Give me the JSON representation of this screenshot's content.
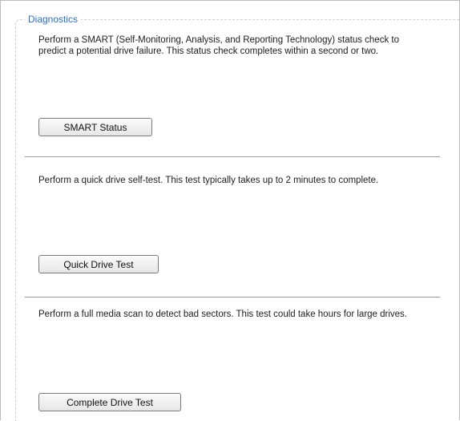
{
  "legend": "Diagnostics",
  "sections": [
    {
      "description": "Perform a SMART (Self-Monitoring, Analysis, and Reporting Technology) status check to predict a potential drive failure. This status check completes within a second or two.",
      "button_label": "SMART Status"
    },
    {
      "description": "Perform a quick drive self-test. This test typically takes up to 2 minutes to complete.",
      "button_label": "Quick Drive Test"
    },
    {
      "description": "Perform a full media scan to detect bad sectors. This test could take hours for large drives.",
      "button_label": "Complete Drive Test"
    }
  ]
}
